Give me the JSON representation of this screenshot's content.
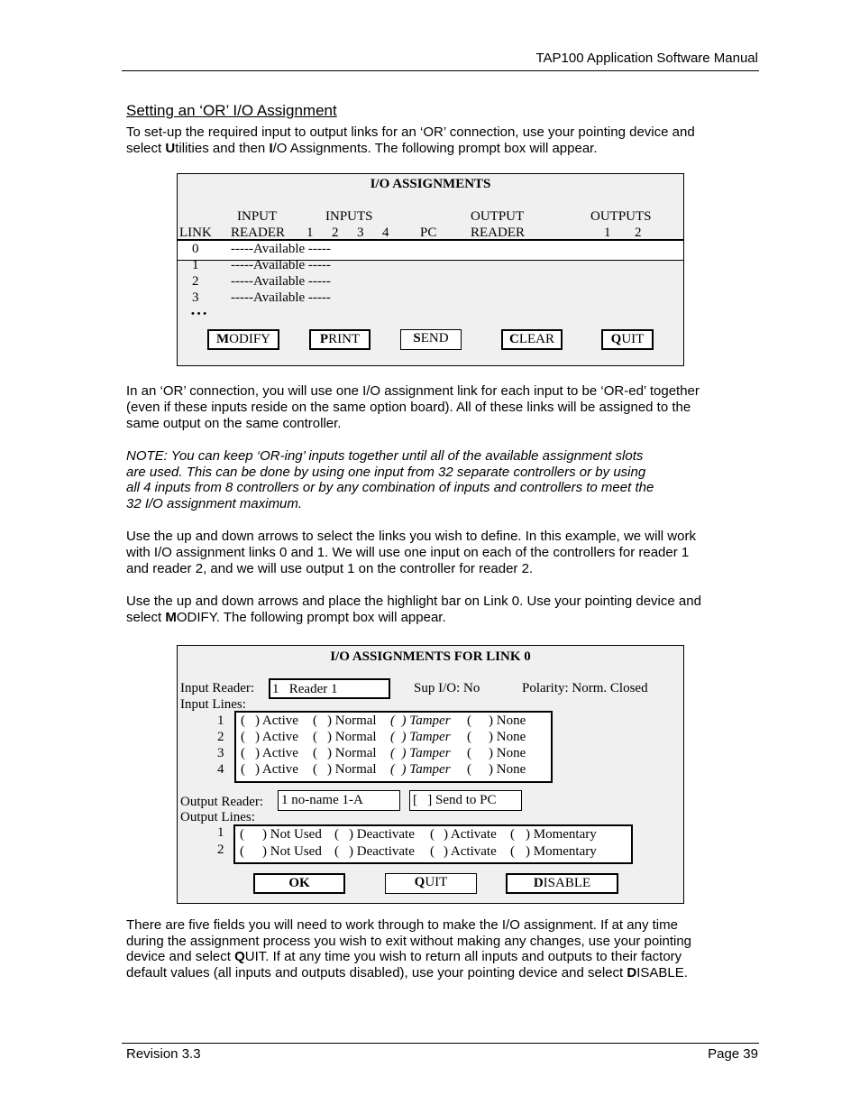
{
  "header": {
    "title": "TAP100 Application Software Manual"
  },
  "section_title": "Setting an ‘OR’ I/O Assignment",
  "para1": {
    "l1": "To set-up the required input to output links for an ‘OR’ connection, use your pointing device and",
    "l2a": "select ",
    "l2b": "U",
    "l2c": "tilities and then ",
    "l2d": "I",
    "l2e": "/O Assignments. The following prompt box will appear."
  },
  "dialog1": {
    "title": "I/O ASSIGNMENTS",
    "headers": {
      "input": "INPUT",
      "inputs": "INPUTS",
      "output": "OUTPUT",
      "outputs": "OUTPUTS",
      "link": "LINK",
      "reader": "READER",
      "i1": "1",
      "i2": "2",
      "i3": "3",
      "i4": "4",
      "pc": "PC",
      "out_reader": "READER",
      "o1": "1",
      "o2": "2"
    },
    "rows": [
      {
        "link": "0",
        "status": "-----Available -----"
      },
      {
        "link": "1",
        "status": "-----Available -----"
      },
      {
        "link": "2",
        "status": "-----Available -----"
      },
      {
        "link": "3",
        "status": "-----Available -----"
      }
    ],
    "ellipsis": "• • •",
    "buttons": [
      {
        "key": "M",
        "rest": "ODIFY"
      },
      {
        "key": "P",
        "rest": "RINT"
      },
      {
        "key": "S",
        "rest": "END"
      },
      {
        "key": "C",
        "rest": "LEAR"
      },
      {
        "key": "Q",
        "rest": "UIT"
      }
    ]
  },
  "para2": [
    "In an ‘OR’ connection, you will use one I/O assignment link for each input to be ‘OR-ed’ together",
    "(even if these inputs reside on the same option board). All of these links will be assigned to the",
    "same output on the same controller."
  ],
  "note": [
    "NOTE: You can keep ‘OR-ing’ inputs together until all of the available assignment slots",
    "are used. This can be done by using one input from 32 separate controllers or by using",
    "all 4 inputs from 8 controllers or by any combination of inputs and controllers to meet the",
    "32 I/O assignment maximum."
  ],
  "para3": [
    "Use the up and down arrows to select the links you wish to define. In this example, we will work",
    "with I/O assignment links 0 and 1. We will use one input on each of the controllers for reader 1",
    "and reader 2, and we will use output 1 on the controller for reader 2."
  ],
  "para4": {
    "l1": "Use the up and down arrows and place the highlight bar on Link 0. Use your pointing device and",
    "l2a": "select ",
    "l2b": "M",
    "l2c": "ODIFY. The following prompt box will appear."
  },
  "dialog2": {
    "title": "I/O ASSIGNMENTS FOR LINK 0",
    "input_reader_label": "Input Reader:",
    "input_reader_value": "1   Reader 1",
    "sup_io": "Sup I/O: No",
    "polarity": "Polarity: Norm. Closed",
    "input_lines_label": "Input Lines:",
    "input_lines": [
      {
        "n": "1"
      },
      {
        "n": "2"
      },
      {
        "n": "3"
      },
      {
        "n": "4"
      }
    ],
    "input_options": {
      "open": "(",
      "active": ") Active",
      "normal": ") Normal",
      "tamper": "(  ) Tamper",
      "none": ") None"
    },
    "output_reader_label": "Output Reader:",
    "output_reader_value": "1 no-name 1-A",
    "send_to_pc": "[   ] Send to PC",
    "output_lines_label": "Output Lines:",
    "output_lines": [
      {
        "n": "1"
      },
      {
        "n": "2"
      }
    ],
    "output_options": {
      "open": "(",
      "not_used": ") Not Used",
      "deactivate": ") Deactivate",
      "activate": ") Activate",
      "momentary": ") Momentary"
    },
    "buttons": [
      {
        "key": "OK",
        "rest": ""
      },
      {
        "key": "Q",
        "rest": "UIT"
      },
      {
        "key": "D",
        "rest": "ISABLE"
      }
    ]
  },
  "para5": {
    "l1": "There are five fields you will need to work through to make the I/O assignment. If at any time",
    "l2": "during the assignment process you wish to exit without making any changes, use your pointing",
    "l3a": "device and select ",
    "l3b": "Q",
    "l3c": "UIT. If at any time you wish to return all inputs and outputs to their factory",
    "l4a": "default values (all inputs and outputs disabled), use your pointing device and select ",
    "l4b": "D",
    "l4c": "ISABLE."
  },
  "footer": {
    "revision": "Revision 3.3",
    "page": "Page 39"
  }
}
